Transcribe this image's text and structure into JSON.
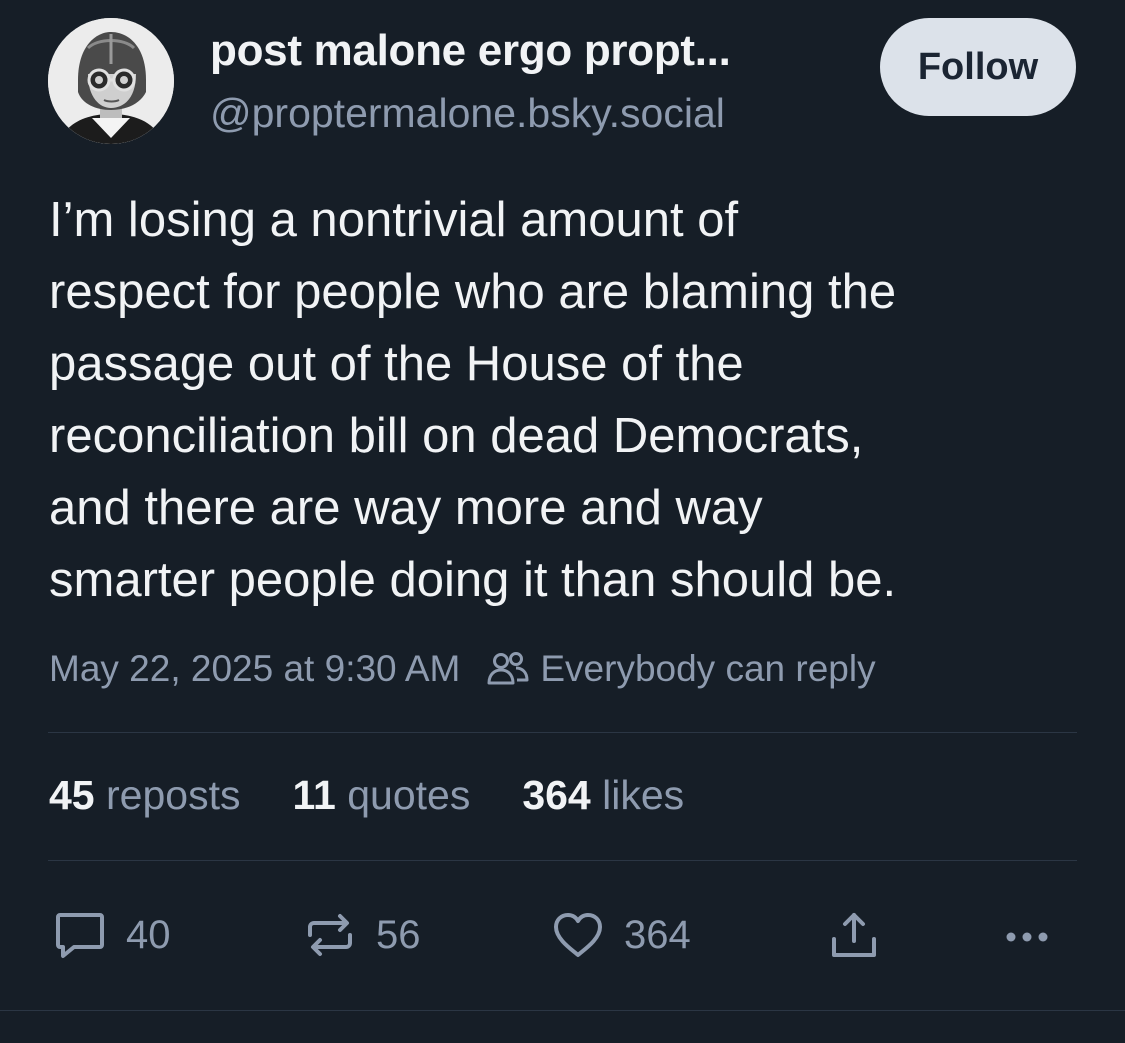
{
  "author": {
    "display_name": "post malone ergo propt...",
    "handle": "@proptermalone.bsky.social",
    "follow_label": "Follow"
  },
  "post": {
    "text_lines": [
      "I’m losing a nontrivial amount of",
      "respect for people who are blaming the",
      "passage out of the House of the",
      "reconciliation bill on dead Democrats,",
      "and there are way more and way",
      "smarter people doing it than should be."
    ],
    "timestamp": "May 22, 2025 at 9:30 AM",
    "reply_setting": "Everybody can reply"
  },
  "stats": {
    "reposts": {
      "count": "45",
      "label": "reposts"
    },
    "quotes": {
      "count": "11",
      "label": "quotes"
    },
    "likes": {
      "count": "364",
      "label": "likes"
    }
  },
  "actions": {
    "reply_count": "40",
    "repost_count": "56",
    "like_count": "364"
  },
  "icons": {
    "reply": "reply-bubble-icon",
    "repost": "repost-arrows-icon",
    "like": "heart-icon",
    "share": "share-icon",
    "more": "ellipsis-icon",
    "audience": "people-icon"
  },
  "colors": {
    "background": "#161e27",
    "text_primary": "#f1f3f5",
    "text_secondary": "#8e9baf",
    "follow_button_bg": "#dce2ea",
    "follow_button_text": "#1b2533",
    "divider": "#2b3644"
  }
}
